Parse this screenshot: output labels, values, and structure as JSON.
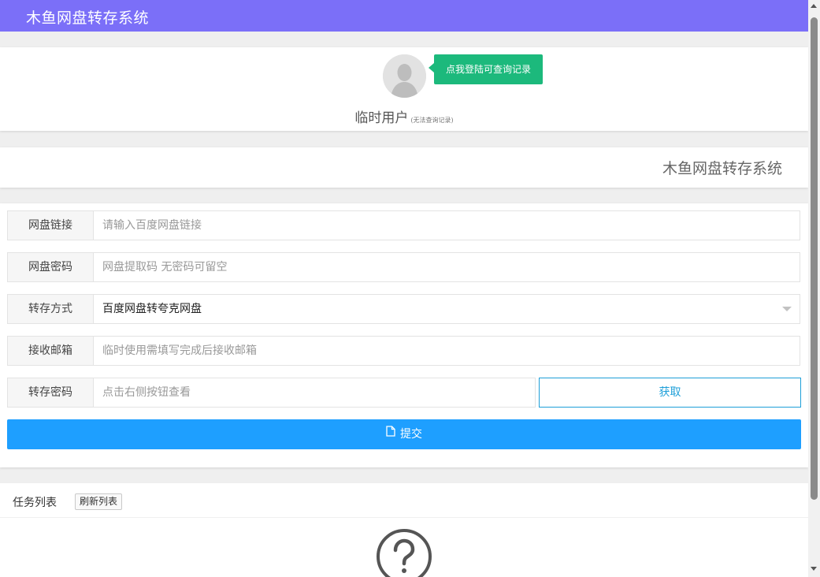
{
  "header": {
    "title": "木鱼网盘转存系统"
  },
  "user": {
    "login_tip": "点我登陆可查询记录",
    "name": "临时用户",
    "note": "(无法查询记录)"
  },
  "banner": {
    "title": "木鱼网盘转存系统"
  },
  "form": {
    "link": {
      "label": "网盘链接",
      "placeholder": "请输入百度网盘链接",
      "value": ""
    },
    "password": {
      "label": "网盘密码",
      "placeholder": "网盘提取码 无密码可留空",
      "value": ""
    },
    "method": {
      "label": "转存方式",
      "value": "百度网盘转夸克网盘"
    },
    "email": {
      "label": "接收邮箱",
      "placeholder": "临时使用需填写完成后接收邮箱",
      "value": ""
    },
    "transfer_code": {
      "label": "转存密码",
      "placeholder": "点击右侧按钮查看",
      "value": ""
    },
    "get_label": "获取",
    "submit_label": "提交"
  },
  "tasks": {
    "title": "任务列表",
    "refresh_label": "刷新列表"
  },
  "colors": {
    "header_bg": "#7b6ff8",
    "login_tip_bg": "#1cb97c",
    "submit_bg": "#1e9fff",
    "get_border": "#1e9fd8"
  },
  "icons": {
    "avatar": "default-avatar-icon",
    "submit": "file-icon",
    "empty": "question-circle-icon"
  }
}
